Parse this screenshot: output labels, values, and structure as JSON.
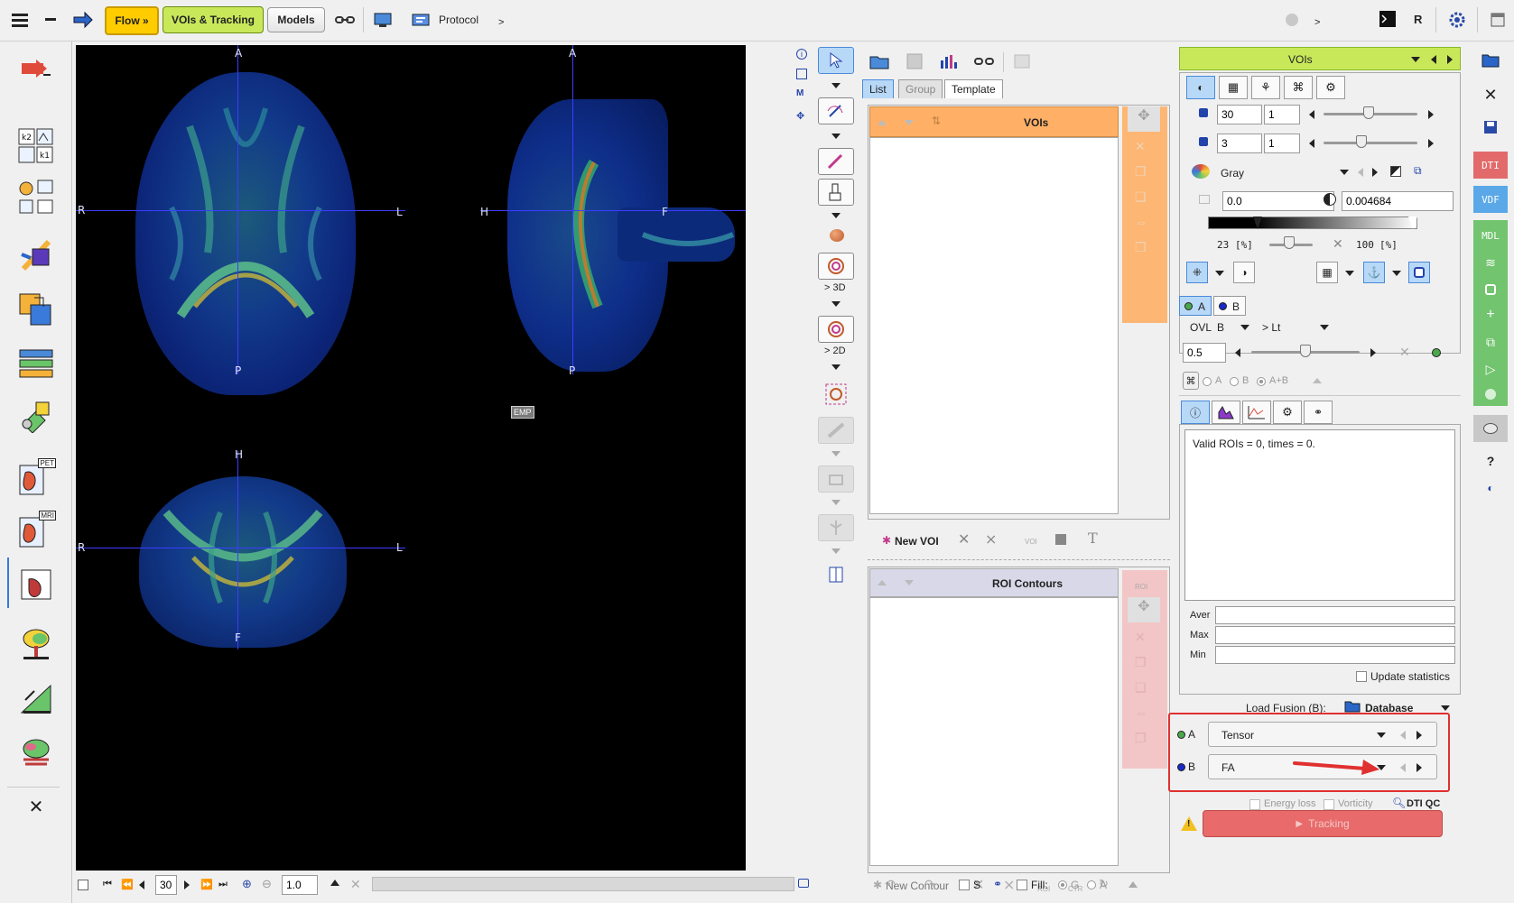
{
  "toolbar": {
    "flow_label": "Flow »",
    "vois_tracking_label": "VOIs & Tracking",
    "models_label": "Models",
    "protocol_label": "Protocol",
    "more": ">",
    "more2": ">",
    "r_label": "R"
  },
  "viewer": {
    "axial": {
      "top": "A",
      "bottom": "P",
      "left": "R",
      "right": "L"
    },
    "sagittal": {
      "top": "A",
      "bottom": "P",
      "left": "H",
      "right": "F"
    },
    "coronal": {
      "top": "H",
      "bottom": "F",
      "left": "R",
      "right": "L"
    },
    "emp_label": "EMP",
    "slice_value": "30",
    "zoom_value": "1.0"
  },
  "tools": {
    "label_3d": "> 3D",
    "label_2d": "> 2D"
  },
  "voi_panel": {
    "tabs": [
      "List",
      "Group",
      "Template"
    ],
    "vois_header": "VOIs",
    "new_voi_label": "New VOI",
    "roi_contours_header": "ROI Contours",
    "new_contour_label": "New Contour",
    "voi_small": "VOI",
    "roi_small": "ROI",
    "ctr_small": "CTR",
    "bottom": {
      "s_label": "S",
      "fill_label": "Fill:",
      "g_label": "G",
      "a_label": "A"
    }
  },
  "right_panel": {
    "header_title": "VOIs",
    "slice_value1": "30",
    "slice_step1": "1",
    "slice_value2": "3",
    "slice_step2": "1",
    "colormap": "Gray",
    "min_value": "0.0",
    "max_value": "0.004684",
    "lower_pct": "23",
    "upper_pct": "100",
    "pct_unit": "[%]",
    "tab_a": "A",
    "tab_b": "B",
    "ovl_label": "OVL",
    "ovl_value": "B",
    "lt_label": "> Lt",
    "fusion_value": "0.5",
    "radio_a": "A",
    "radio_b": "B",
    "radio_ab": "A+B",
    "stats_text": "Valid ROIs = 0, times = 0.",
    "aver_label": "Aver",
    "max_label": "Max",
    "min_label": "Min",
    "update_stats_label": "Update statistics",
    "load_fusion_label": "Load Fusion (B):",
    "database_label": "Database",
    "series_a_label": "A",
    "series_a_value": "Tensor",
    "series_b_label": "B",
    "series_b_value": "FA",
    "energy_loss_label": "Energy loss",
    "vorticity_label": "Vorticity",
    "dti_qc_label": "DTI QC",
    "tracking_label": "Tracking"
  },
  "right_strip": {
    "dti_label": "DTI",
    "vdf_label": "VDF",
    "mdl_label": "MDL",
    "help_label": "?"
  },
  "left_sidebar": {
    "pet_label": "PET",
    "mri_label": "MRI",
    "k2_label": "k2",
    "k1_label": "k1"
  },
  "colors": {
    "flow_yellow": "#ffcc00",
    "vois_green": "#c8e85a",
    "selected_blue": "#b8d8f8",
    "vois_orange": "#ffb066",
    "roi_pink": "#f2c6c6",
    "tracking_red": "#e86a6a",
    "highlight_red": "#e03030",
    "strip_red": "#e26a6a",
    "strip_blue": "#5aa8e8",
    "strip_green": "#72c46e"
  }
}
